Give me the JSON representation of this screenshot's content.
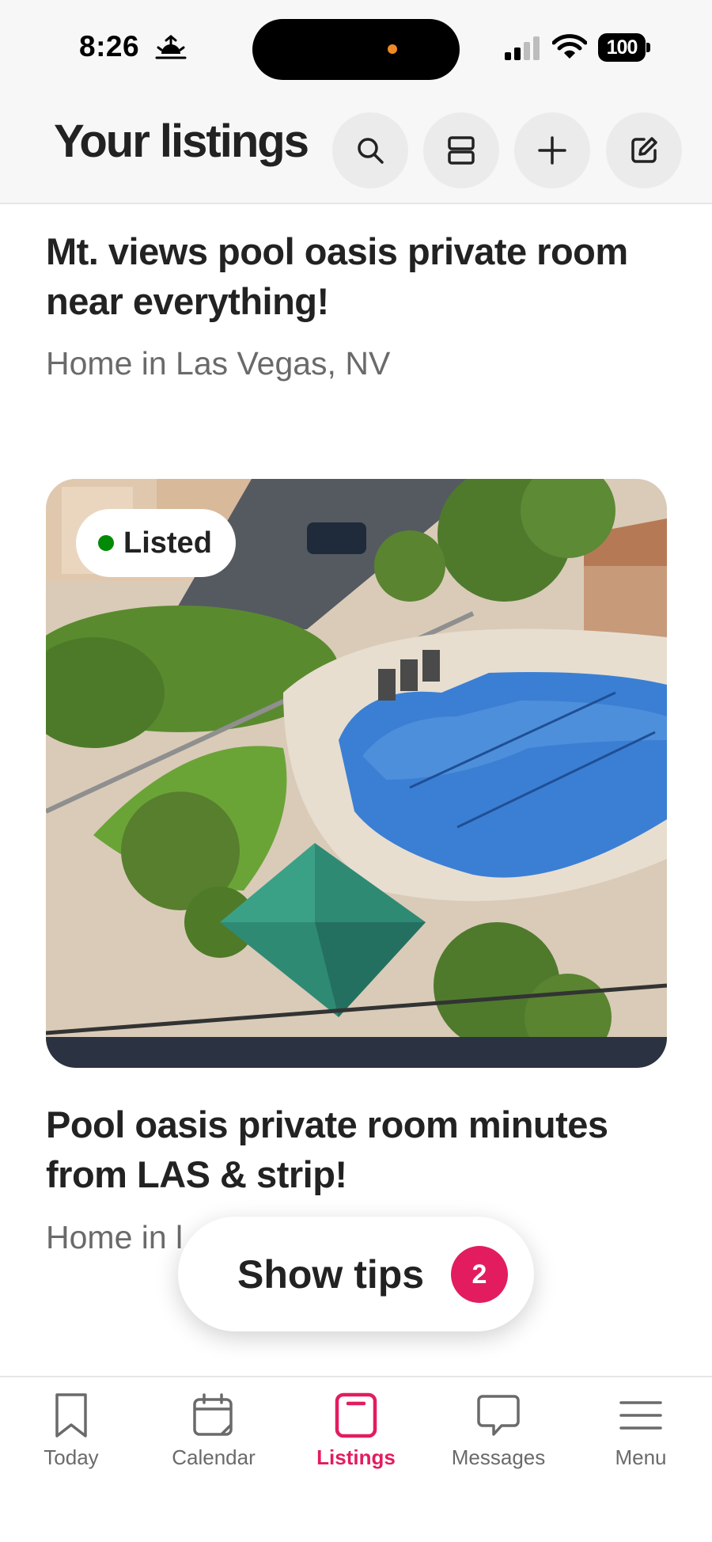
{
  "status_bar": {
    "time": "8:26",
    "battery": "100",
    "icons": [
      "sunrise-icon",
      "signal-icon",
      "wifi-icon",
      "battery-icon"
    ]
  },
  "header": {
    "title": "Your listings",
    "actions": [
      "search-icon",
      "view-toggle-icon",
      "add-icon",
      "edit-icon"
    ]
  },
  "listings": [
    {
      "title": "Mt. views pool oasis private room near everything!",
      "subtitle": "Home in Las Vegas, NV"
    },
    {
      "status": "Listed",
      "title": "Pool oasis private room minutes from LAS & strip!",
      "subtitle": "Home in l"
    }
  ],
  "tips": {
    "label": "Show tips",
    "count": "2"
  },
  "tabs": [
    {
      "label": "Today",
      "icon": "bookmark-icon"
    },
    {
      "label": "Calendar",
      "icon": "calendar-icon"
    },
    {
      "label": "Listings",
      "icon": "listings-icon",
      "active": true
    },
    {
      "label": "Messages",
      "icon": "message-icon"
    },
    {
      "label": "Menu",
      "icon": "menu-icon"
    }
  ],
  "colors": {
    "accent": "#e31c5f",
    "listed_dot": "#008a05",
    "text_primary": "#222222",
    "text_secondary": "#6a6a6a"
  }
}
